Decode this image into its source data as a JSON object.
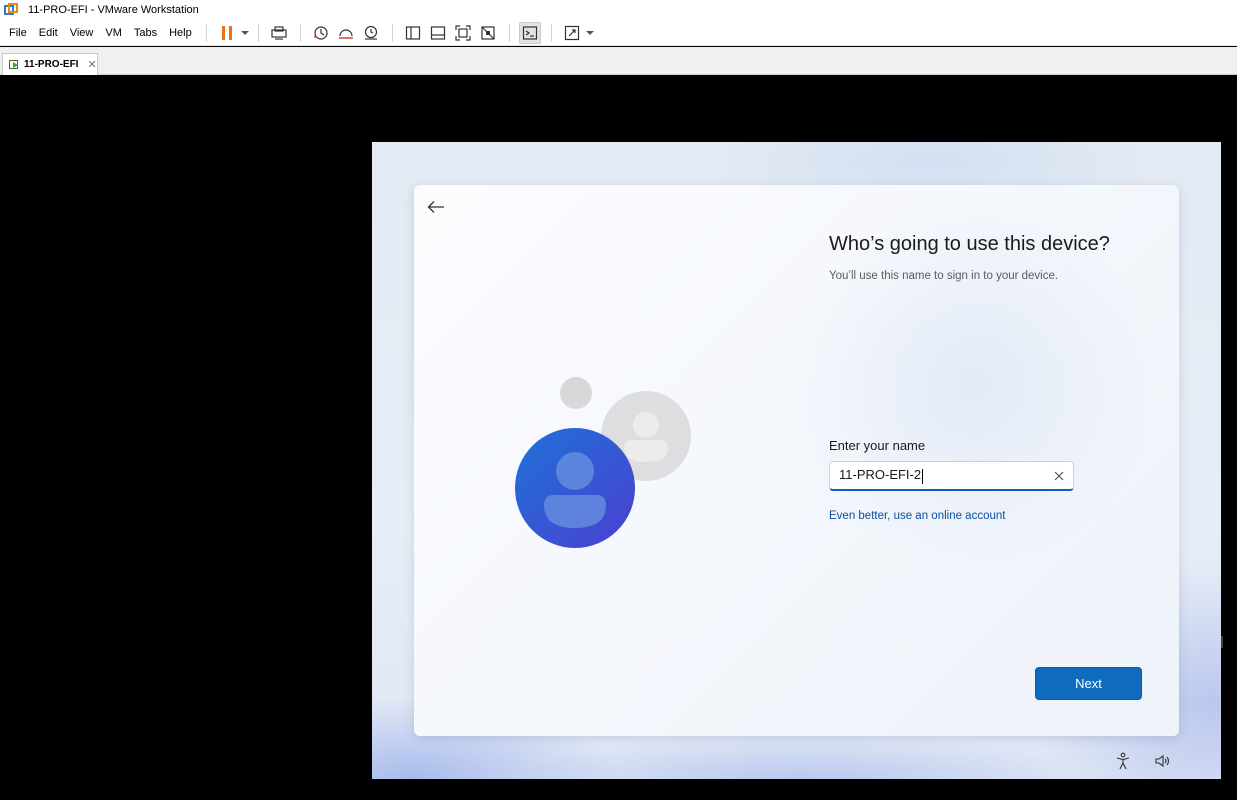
{
  "window": {
    "title": "11-PRO-EFI - VMware Workstation"
  },
  "menu": {
    "items": [
      "File",
      "Edit",
      "View",
      "VM",
      "Tabs",
      "Help"
    ]
  },
  "toolbar": {
    "icons": [
      "pause-icon",
      "send-keys-icon",
      "snapshot-icon",
      "revert-snapshot-icon",
      "snapshot-manager-icon",
      "library-icon",
      "thumbnail-bar-icon",
      "full-screen-icon",
      "unity-icon",
      "console-view-icon",
      "stretch-guest-icon"
    ]
  },
  "tabs": [
    {
      "label": "11-PRO-EFI"
    }
  ],
  "oobe": {
    "heading": "Who’s going to use this device?",
    "subtext": "You’ll use this name to sign in to your device.",
    "name_label": "Enter your name",
    "name_value": "11-PRO-EFI-2",
    "online_link": "Even better, use an online account",
    "next_label": "Next"
  },
  "colors": {
    "accent": "#0f6cbd",
    "link": "#0a4fa0",
    "pause_orange": "#e8731c"
  }
}
